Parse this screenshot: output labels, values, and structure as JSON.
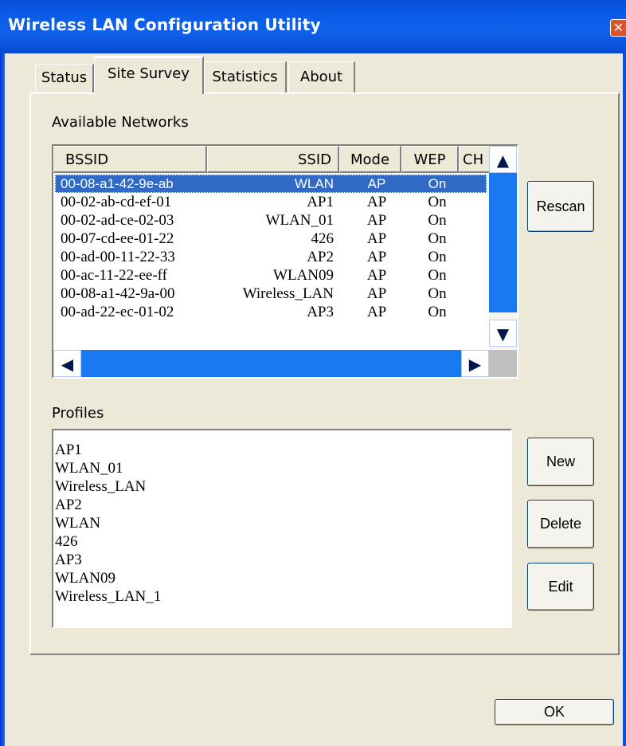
{
  "window": {
    "title": "Wireless LAN Configuration Utility",
    "close_glyph": "✕"
  },
  "tabs": [
    {
      "label": "Status"
    },
    {
      "label": "Site Survey",
      "selected": true
    },
    {
      "label": "Statistics"
    },
    {
      "label": "About"
    }
  ],
  "networks": {
    "label": "Available Networks",
    "columns": [
      "BSSID",
      "SSID",
      "Mode",
      "WEP",
      "CH"
    ],
    "rows": [
      {
        "bssid": "00-08-a1-42-9e-ab",
        "ssid": "WLAN",
        "mode": "AP",
        "wep": "On",
        "selected": true
      },
      {
        "bssid": "00-02-ab-cd-ef-01",
        "ssid": "AP1",
        "mode": "AP",
        "wep": "On"
      },
      {
        "bssid": "00-02-ad-ce-02-03",
        "ssid": "WLAN_01",
        "mode": "AP",
        "wep": "On"
      },
      {
        "bssid": "00-07-cd-ee-01-22",
        "ssid": "426",
        "mode": "AP",
        "wep": "On"
      },
      {
        "bssid": "00-ad-00-11-22-33",
        "ssid": "AP2",
        "mode": "AP",
        "wep": "On"
      },
      {
        "bssid": "00-ac-11-22-ee-ff",
        "ssid": "WLAN09",
        "mode": "AP",
        "wep": "On"
      },
      {
        "bssid": "00-08-a1-42-9a-00",
        "ssid": "Wireless_LAN",
        "mode": "AP",
        "wep": "On"
      },
      {
        "bssid": "00-ad-22-ec-01-02",
        "ssid": "AP3",
        "mode": "AP",
        "wep": "On"
      }
    ],
    "scroll": {
      "up": "▲",
      "down": "▼",
      "left": "◀",
      "right": "▶"
    }
  },
  "profiles": {
    "label": "Profiles",
    "items": [
      "AP1",
      "WLAN_01",
      "Wireless_LAN",
      "AP2",
      "WLAN",
      "426",
      "AP3",
      "WLAN09",
      "Wireless_LAN_1"
    ]
  },
  "buttons": {
    "rescan": "Rescan",
    "new": "New",
    "delete": "Delete",
    "edit": "Edit",
    "ok": "OK"
  },
  "colors": {
    "titlebar": "#0a5be8",
    "selection": "#316ac5",
    "dialog_bg": "#ece9d8"
  }
}
